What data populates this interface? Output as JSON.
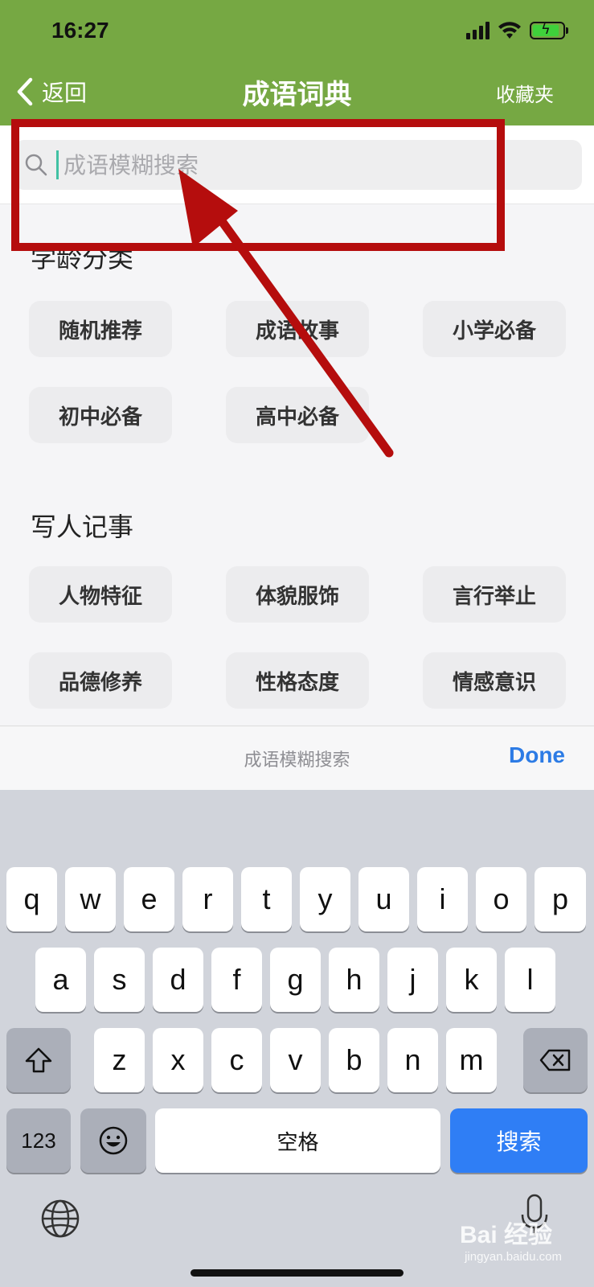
{
  "status": {
    "time": "16:27",
    "icons": [
      "signal-icon",
      "wifi-icon",
      "battery-charging-icon"
    ]
  },
  "nav": {
    "back_label": "返回",
    "title": "成语词典",
    "right_label": "收藏夹"
  },
  "search": {
    "placeholder": "成语模糊搜索"
  },
  "sections": [
    {
      "title": "学龄分类",
      "chips": [
        "随机推荐",
        "成语故事",
        "小学必备",
        "初中必备",
        "高中必备"
      ]
    },
    {
      "title": "写人记事",
      "chips": [
        "人物特征",
        "体貌服饰",
        "言行举止",
        "品德修养",
        "性格态度",
        "情感意识"
      ]
    }
  ],
  "accessory": {
    "label": "成语模糊搜索",
    "done": "Done"
  },
  "keyboard": {
    "row1": [
      "q",
      "w",
      "e",
      "r",
      "t",
      "y",
      "u",
      "i",
      "o",
      "p"
    ],
    "row2": [
      "a",
      "s",
      "d",
      "f",
      "g",
      "h",
      "j",
      "k",
      "l"
    ],
    "row3": [
      "z",
      "x",
      "c",
      "v",
      "b",
      "n",
      "m"
    ],
    "numbers": "123",
    "space": "空格",
    "search": "搜索"
  },
  "watermark": {
    "brand": "Bai 经验",
    "url": "jingyan.baidu.com"
  },
  "colors": {
    "nav_green": "#76a843",
    "annotation_red": "#b50d0d",
    "key_blue": "#2f7ef5",
    "done_blue": "#2c7be5"
  }
}
